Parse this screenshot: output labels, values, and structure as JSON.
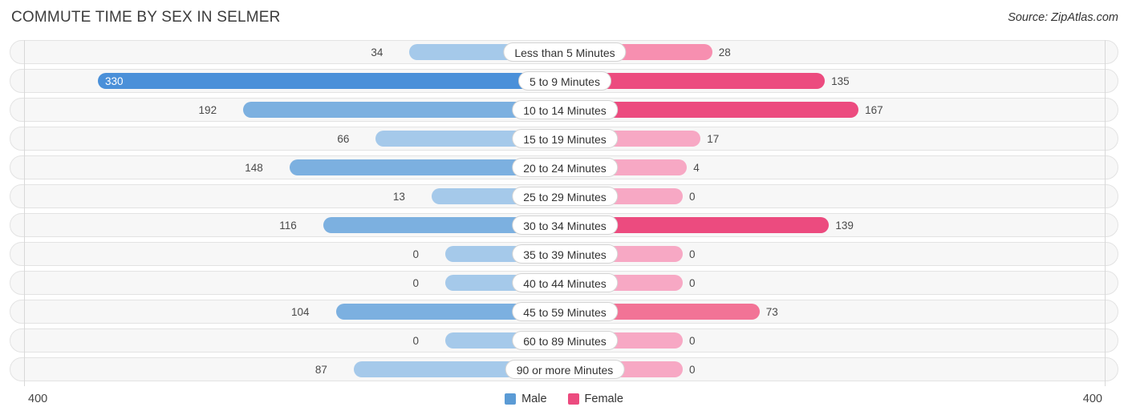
{
  "header": {
    "title": "COMMUTE TIME BY SEX IN SELMER",
    "source": "Source: ZipAtlas.com"
  },
  "legend": {
    "male_label": "Male",
    "female_label": "Female",
    "male_color": "#5b9bd5",
    "female_color": "#ec4b7f"
  },
  "axis": {
    "left_label": "400",
    "right_label": "400",
    "max": 400
  },
  "chart_data": {
    "type": "bar",
    "title": "COMMUTE TIME BY SEX IN SELMER",
    "xlabel": "",
    "ylabel": "",
    "orientation": "horizontal-diverging",
    "xlim": [
      0,
      400
    ],
    "grid": false,
    "legend_position": "bottom-center",
    "categories": [
      "Less than 5 Minutes",
      "5 to 9 Minutes",
      "10 to 14 Minutes",
      "15 to 19 Minutes",
      "20 to 24 Minutes",
      "25 to 29 Minutes",
      "30 to 34 Minutes",
      "35 to 39 Minutes",
      "40 to 44 Minutes",
      "45 to 59 Minutes",
      "60 to 89 Minutes",
      "90 or more Minutes"
    ],
    "series": [
      {
        "name": "Male",
        "color": "#5b9bd5",
        "values": [
          34,
          330,
          192,
          66,
          148,
          13,
          116,
          0,
          0,
          104,
          0,
          87
        ]
      },
      {
        "name": "Female",
        "color": "#ec4b7f",
        "values": [
          28,
          135,
          167,
          17,
          4,
          0,
          139,
          0,
          0,
          73,
          0,
          0
        ]
      }
    ]
  },
  "rows": [
    {
      "label": "Less than 5 Minutes",
      "male": "34",
      "female": "28"
    },
    {
      "label": "5 to 9 Minutes",
      "male": "330",
      "female": "135"
    },
    {
      "label": "10 to 14 Minutes",
      "male": "192",
      "female": "167"
    },
    {
      "label": "15 to 19 Minutes",
      "male": "66",
      "female": "17"
    },
    {
      "label": "20 to 24 Minutes",
      "male": "148",
      "female": "4"
    },
    {
      "label": "25 to 29 Minutes",
      "male": "13",
      "female": "0"
    },
    {
      "label": "30 to 34 Minutes",
      "male": "116",
      "female": "139"
    },
    {
      "label": "35 to 39 Minutes",
      "male": "0",
      "female": "0"
    },
    {
      "label": "40 to 44 Minutes",
      "male": "0",
      "female": "0"
    },
    {
      "label": "45 to 59 Minutes",
      "male": "104",
      "female": "73"
    },
    {
      "label": "60 to 89 Minutes",
      "male": "0",
      "female": "0"
    },
    {
      "label": "90 or more Minutes",
      "male": "87",
      "female": "0"
    }
  ]
}
